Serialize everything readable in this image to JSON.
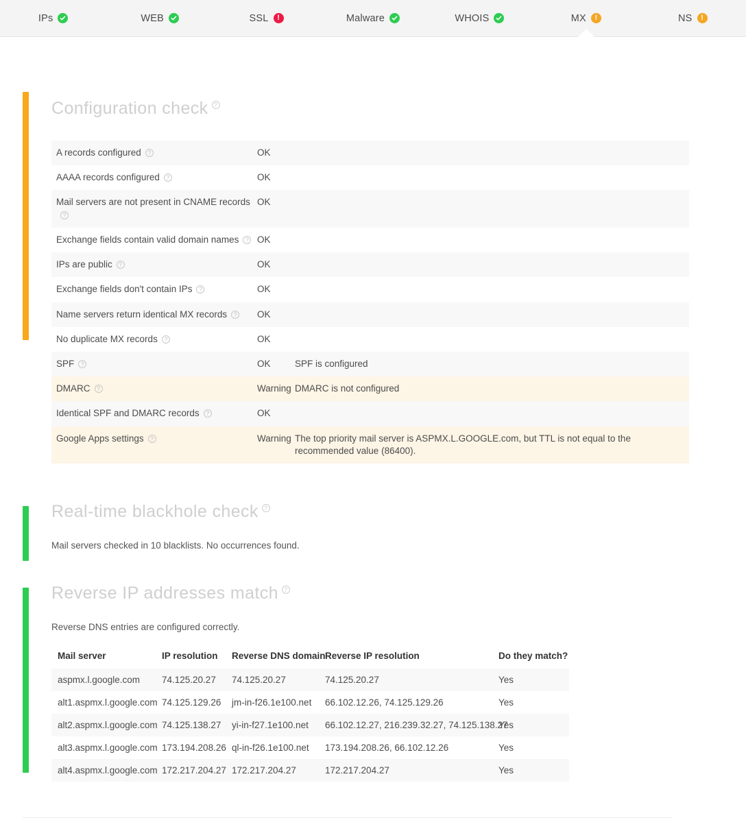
{
  "tabs": [
    {
      "label": "IPs",
      "status": "ok",
      "active": false,
      "icon": "check-circle-icon"
    },
    {
      "label": "WEB",
      "status": "ok",
      "active": false,
      "icon": "check-circle-icon"
    },
    {
      "label": "SSL",
      "status": "error",
      "active": false,
      "icon": "error-circle-icon"
    },
    {
      "label": "Malware",
      "status": "ok",
      "active": false,
      "icon": "check-circle-icon"
    },
    {
      "label": "WHOIS",
      "status": "ok",
      "active": false,
      "icon": "check-circle-icon"
    },
    {
      "label": "MX",
      "status": "warning",
      "active": true,
      "icon": "warning-circle-icon"
    },
    {
      "label": "NS",
      "status": "warning",
      "active": false,
      "icon": "warning-circle-icon"
    }
  ],
  "help_glyph": "?",
  "colors": {
    "ok": "#2ecc52",
    "error": "#ec1944",
    "warning": "#f5a623",
    "accent_orange": "#f7a81b",
    "accent_green": "#2ecc52",
    "warn_row_bg": "#fdf5e6",
    "stripe_bg": "#f8f8f8"
  },
  "config_check": {
    "title": "Configuration check",
    "accent": "orange",
    "rows": [
      {
        "label": "A records configured",
        "status": "OK",
        "detail": "",
        "level": "ok"
      },
      {
        "label": "AAAA records configured",
        "status": "OK",
        "detail": "",
        "level": "ok"
      },
      {
        "label": "Mail servers are not present in CNAME records",
        "status": "OK",
        "detail": "",
        "level": "ok"
      },
      {
        "label": "Exchange fields contain valid domain names",
        "status": "OK",
        "detail": "",
        "level": "ok"
      },
      {
        "label": "IPs are public",
        "status": "OK",
        "detail": "",
        "level": "ok"
      },
      {
        "label": "Exchange fields don't contain IPs",
        "status": "OK",
        "detail": "",
        "level": "ok"
      },
      {
        "label": "Name servers return identical MX records",
        "status": "OK",
        "detail": "",
        "level": "ok"
      },
      {
        "label": "No duplicate MX records",
        "status": "OK",
        "detail": "",
        "level": "ok"
      },
      {
        "label": "SPF",
        "status": "OK",
        "detail": "SPF is configured",
        "level": "ok"
      },
      {
        "label": "DMARC",
        "status": "Warning",
        "detail": "DMARC is not configured",
        "level": "warn"
      },
      {
        "label": "Identical SPF and DMARC records",
        "status": "OK",
        "detail": "",
        "level": "ok"
      },
      {
        "label": "Google Apps settings",
        "status": "Warning",
        "detail": "The top priority mail server is ASPMX.L.GOOGLE.com, but TTL is not equal to the recommended value (86400).",
        "level": "warn"
      }
    ]
  },
  "blackhole_check": {
    "title": "Real-time blackhole check",
    "accent": "green",
    "note": "Mail servers checked in 10 blacklists. No occurrences found."
  },
  "reverse_ip": {
    "title": "Reverse IP addresses match",
    "accent": "green",
    "note": "Reverse DNS entries are configured correctly.",
    "headers": [
      "Mail server",
      "IP resolution",
      "Reverse DNS domain",
      "Reverse IP resolution",
      "Do they match?"
    ],
    "rows": [
      {
        "mail_server": "aspmx.l.google.com",
        "ip_resolution": "74.125.20.27",
        "reverse_dns_domain": "74.125.20.27",
        "reverse_ip_resolution": "74.125.20.27",
        "match": "Yes"
      },
      {
        "mail_server": "alt1.aspmx.l.google.com",
        "ip_resolution": "74.125.129.26",
        "reverse_dns_domain": "jm-in-f26.1e100.net",
        "reverse_ip_resolution": "66.102.12.26, 74.125.129.26",
        "match": "Yes"
      },
      {
        "mail_server": "alt2.aspmx.l.google.com",
        "ip_resolution": "74.125.138.27",
        "reverse_dns_domain": "yi-in-f27.1e100.net",
        "reverse_ip_resolution": "66.102.12.27, 216.239.32.27, 74.125.138.27",
        "match": "Yes"
      },
      {
        "mail_server": "alt3.aspmx.l.google.com",
        "ip_resolution": "173.194.208.26",
        "reverse_dns_domain": "ql-in-f26.1e100.net",
        "reverse_ip_resolution": "173.194.208.26, 66.102.12.26",
        "match": "Yes"
      },
      {
        "mail_server": "alt4.aspmx.l.google.com",
        "ip_resolution": "172.217.204.27",
        "reverse_dns_domain": "172.217.204.27",
        "reverse_ip_resolution": "172.217.204.27",
        "match": "Yes"
      }
    ]
  }
}
